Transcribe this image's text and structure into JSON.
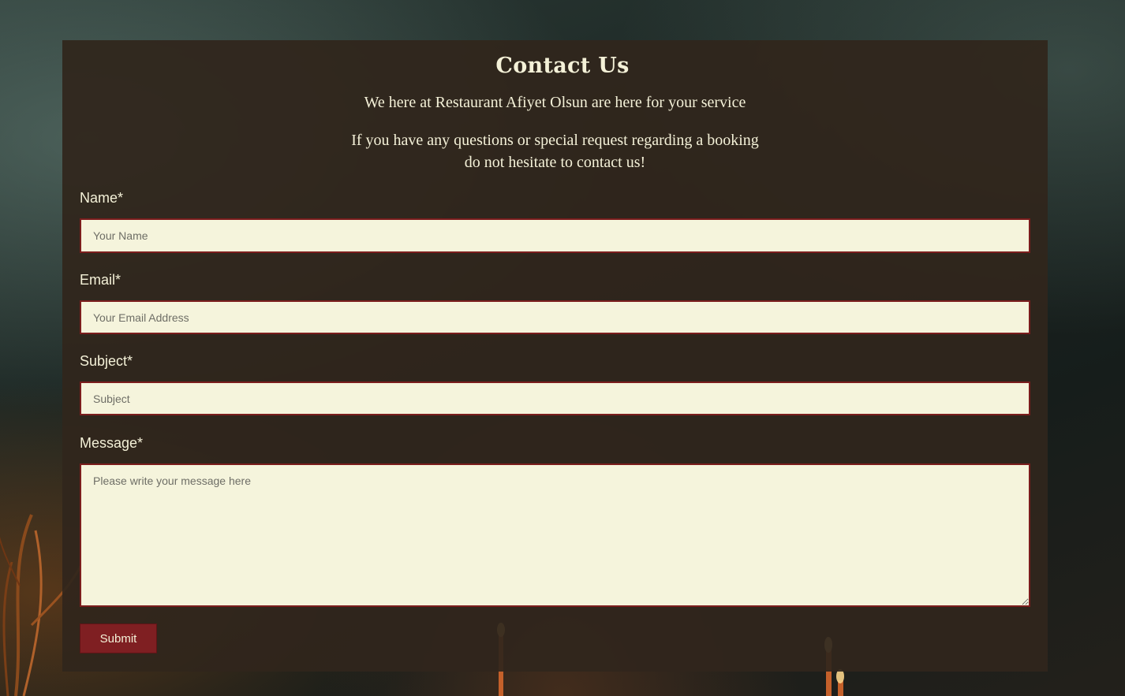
{
  "header": {
    "title": "Contact Us",
    "tagline": "We here at Restaurant Afiyet Olsun are here for your service",
    "intro_line1": "If you have any questions or special request regarding a booking",
    "intro_line2": "do not hesitate to contact us!"
  },
  "form": {
    "name_label": "Name*",
    "name_placeholder": "Your Name",
    "email_label": "Email*",
    "email_placeholder": "Your Email Address",
    "subject_label": "Subject*",
    "subject_placeholder": "Subject",
    "message_label": "Message*",
    "message_placeholder": "Please write your message here",
    "submit_label": "Submit"
  },
  "colors": {
    "panel": "#30261c",
    "field_background": "#f5f4dc",
    "field_border": "#7b1d1d",
    "button": "#7f1f22",
    "text": "#f4f1d8"
  }
}
